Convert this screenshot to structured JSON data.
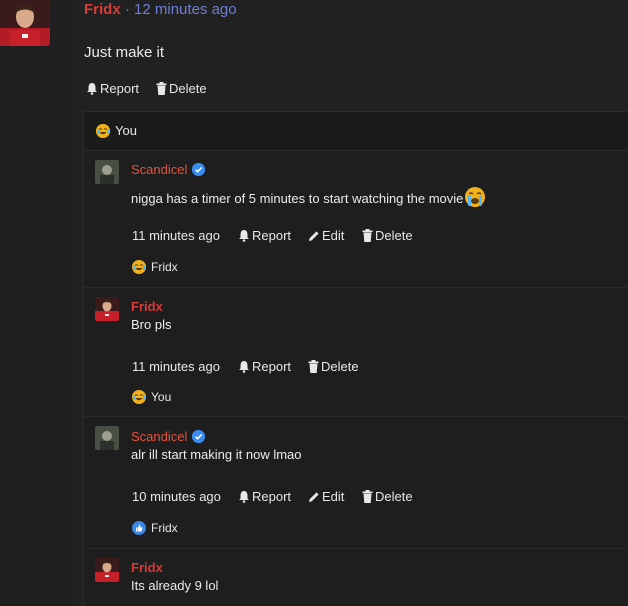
{
  "post": {
    "author": "Fridx",
    "separator": "·",
    "time": "12 minutes ago",
    "text": "Just make it",
    "actions": {
      "report": "Report",
      "delete": "Delete"
    }
  },
  "reaction_bar": {
    "emoji": "joy-emoji",
    "label": "You"
  },
  "replies": [
    {
      "author": "Scandicel",
      "verified": true,
      "text": "nigga has a timer of 5 minutes to start watching the movie",
      "trailing_emoji": "crying-emoji",
      "time": "11 minutes ago",
      "report": "Report",
      "edit": "Edit",
      "delete": "Delete",
      "reaction_emoji": "joy-emoji",
      "reaction_label": "Fridx"
    },
    {
      "author": "Fridx",
      "verified": false,
      "text": "Bro pls",
      "time": "11 minutes ago",
      "report": "Report",
      "delete": "Delete",
      "reaction_emoji": "joy-emoji",
      "reaction_label": "You"
    },
    {
      "author": "Scandicel",
      "verified": true,
      "text": "alr ill start making it now lmao",
      "time": "10 minutes ago",
      "report": "Report",
      "edit": "Edit",
      "delete": "Delete",
      "reaction_emoji": "thumbs-up-emoji",
      "reaction_label": "Fridx"
    },
    {
      "author": "Fridx",
      "verified": false,
      "text": "Its already 9 lol"
    }
  ],
  "colors": {
    "background": "#1f1f1f",
    "author_red": "#d93a3a",
    "author_orange": "#e2553f",
    "time_blue": "#6d7fd6",
    "verified_blue": "#3a8df0"
  }
}
